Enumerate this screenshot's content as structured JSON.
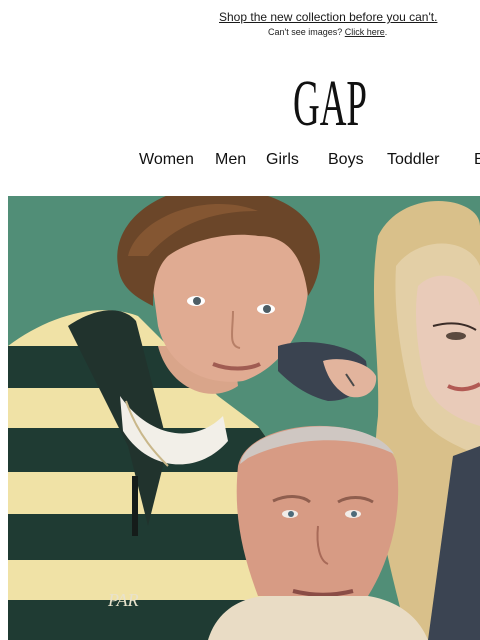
{
  "preheader": {
    "link_text": "Shop the new collection before you can't.",
    "sub_text": "Can't see images?",
    "sub_link": "Click here",
    "sub_suffix": "."
  },
  "brand": {
    "logo_text": "GAP",
    "logo_color": "#111111"
  },
  "nav": {
    "items": [
      {
        "label": "Women"
      },
      {
        "label": "Men"
      },
      {
        "label": "Girls"
      },
      {
        "label": "Boys"
      },
      {
        "label": "Toddler"
      },
      {
        "label": "B"
      }
    ]
  },
  "hero": {
    "background_color": "#4e8a73",
    "sweater_logo_text": "PAR"
  }
}
